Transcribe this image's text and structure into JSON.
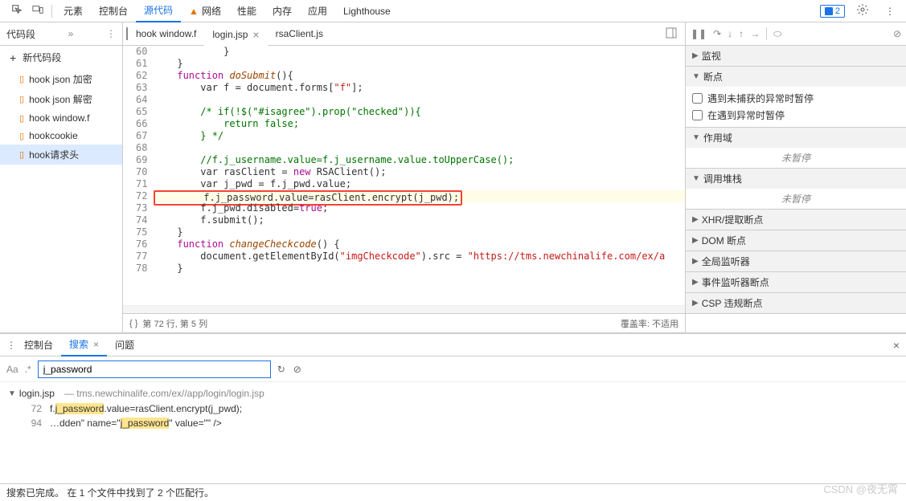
{
  "top_tabs": {
    "elements": "元素",
    "console": "控制台",
    "sources": "源代码",
    "network": "网络",
    "performance": "性能",
    "memory": "内存",
    "application": "应用",
    "lighthouse": "Lighthouse"
  },
  "badge_count": "2",
  "sidebar": {
    "title": "代码段",
    "new_snippet": "新代码段",
    "items": [
      "hook json 加密",
      "hook json 解密",
      "hook window.f",
      "hookcookie",
      "hook请求头"
    ]
  },
  "editor": {
    "tabs": {
      "t0": "hook window.f",
      "t1": "login.jsp",
      "t2": "rsaClient.js"
    },
    "gutter": [
      "60",
      "61",
      "62",
      "63",
      "64",
      "65",
      "66",
      "67",
      "68",
      "69",
      "70",
      "71",
      "72",
      "73",
      "74",
      "75",
      "76",
      "77",
      "78"
    ],
    "lines": {
      "l60": "            }",
      "l61": "    }",
      "l62a": "    function ",
      "l62b": "doSubmit",
      "l62c": "(){",
      "l63a": "        var f = document.forms[",
      "l63b": "\"f\"",
      "l63c": "];",
      "l64": "",
      "l65a": "        /* if(!$(\"#isagree\").prop(\"checked\")){",
      "l66": "            return false;",
      "l67": "        } */",
      "l68": "",
      "l69": "        //f.j_username.value=f.j_username.value.toUpperCase();",
      "l70a": "        var rasClient = ",
      "l70b": "new",
      "l70c": " RSAClient();",
      "l71": "        var j_pwd = f.j_pwd.value;",
      "l72": "        f.j_password.value=rasClient.encrypt(j_pwd);",
      "l73a": "        f.j_pwd.disabled=",
      "l73b": "true",
      "l73c": ";",
      "l74": "        f.submit();",
      "l75": "    }",
      "l76a": "    function ",
      "l76b": "changeCheckcode",
      "l76c": "() {",
      "l77a": "        document.getElementById(",
      "l77b": "\"imgCheckcode\"",
      "l77c": ").src = ",
      "l77d": "\"https://tms.newchinalife.com/ex/a",
      "l78": "    }"
    },
    "footer": {
      "braces": "{ }",
      "position": "第 72 行, 第 5 列",
      "coverage": "覆盖率: 不适用"
    }
  },
  "right": {
    "sections": {
      "watch": "监视",
      "breakpoints": "断点",
      "bp1": "遇到未捕获的异常时暂停",
      "bp2": "在遇到异常时暂停",
      "scope": "作用域",
      "paused": "未暂停",
      "callstack": "调用堆栈",
      "xhr": "XHR/提取断点",
      "dom": "DOM 断点",
      "global": "全局监听器",
      "event": "事件监听器断点",
      "csp": "CSP 违规断点"
    }
  },
  "drawer": {
    "tabs": {
      "console": "控制台",
      "search": "搜索",
      "issues": "问题"
    },
    "search_input": "j_password",
    "result_file": "login.jsp",
    "result_path": "tms.newchinalife.com/ex//app/login/login.jsp",
    "r1_num": "72",
    "r1_a": "f.",
    "r1_b": "j_password",
    "r1_c": ".value=rasClient.encrypt(j_pwd);",
    "r2_num": "94",
    "r2_a": "…dden\" name=\"",
    "r2_b": "j_password",
    "r2_c": "\" value=\"\" />"
  },
  "status_bar": "搜索已完成。  在 1 个文件中找到了 2 个匹配行。",
  "watermark": "CSDN @夜无霄"
}
